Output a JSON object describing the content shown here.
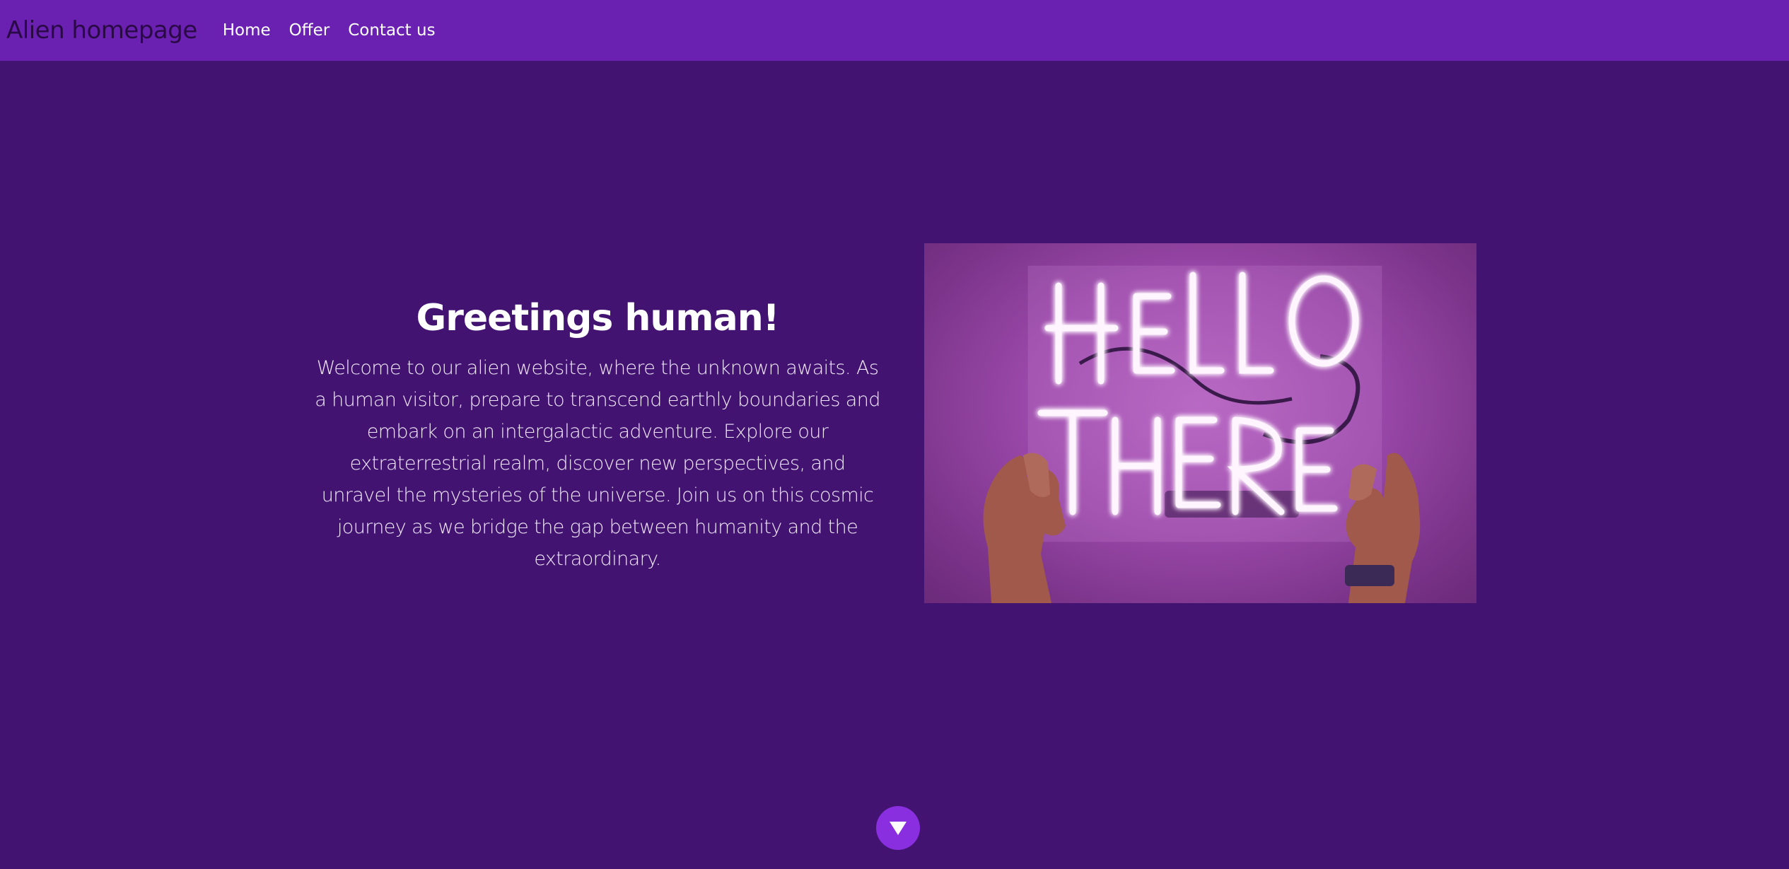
{
  "navbar": {
    "brand": "Alien homepage",
    "links": [
      "Home",
      "Offer",
      "Contact us"
    ]
  },
  "hero": {
    "title": "Greetings human!",
    "body": "Welcome to our alien website, where the unknown awaits. As a human visitor, prepare to transcend earthly boundaries and embark on an intergalactic adventure. Explore our extraterrestrial realm, discover new perspectives, and unravel the mysteries of the universe. Join us on this cosmic journey as we bridge the gap between humanity and the extraordinary.",
    "image_text": [
      "HELLO",
      "THERE"
    ]
  },
  "scroll_button": {
    "icon": "triangle-down-icon"
  },
  "colors": {
    "navbar": "#6a21b2",
    "background": "#421370",
    "button": "#8a2fe0"
  }
}
